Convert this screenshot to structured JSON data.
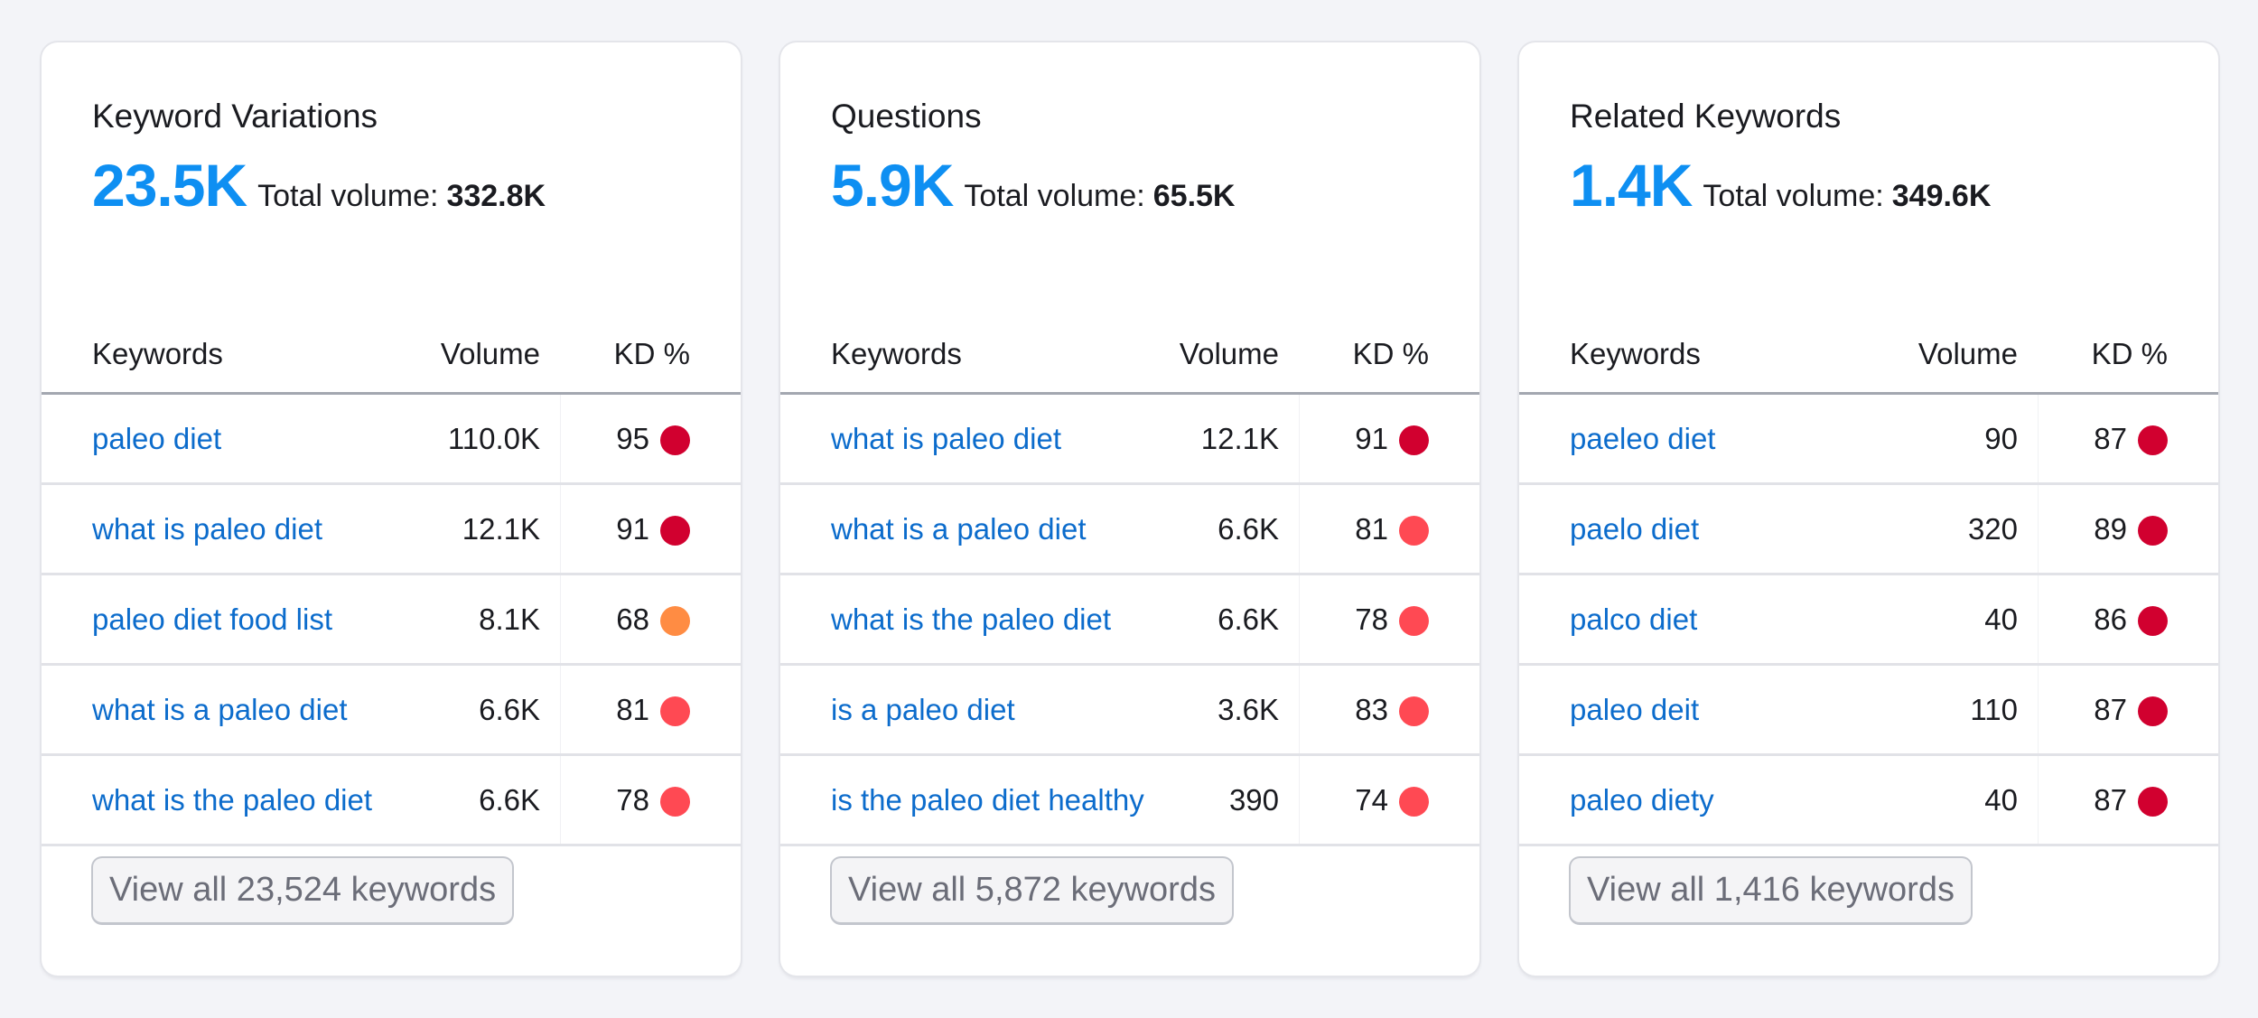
{
  "kd_colors": {
    "very_hard": "#d1002f",
    "hard": "#ff4953",
    "difficult": "#ff8c43"
  },
  "table_headers": {
    "keyword": "Keywords",
    "volume": "Volume",
    "kd": "KD %"
  },
  "cards": [
    {
      "title": "Keyword Variations",
      "count": "23.5K",
      "total_label": "Total volume:",
      "total_value": "332.8K",
      "rows": [
        {
          "keyword": "paleo diet",
          "volume": "110.0K",
          "kd": "95",
          "kd_level": "very_hard"
        },
        {
          "keyword": "what is paleo diet",
          "volume": "12.1K",
          "kd": "91",
          "kd_level": "very_hard"
        },
        {
          "keyword": "paleo diet food list",
          "volume": "8.1K",
          "kd": "68",
          "kd_level": "difficult"
        },
        {
          "keyword": "what is a paleo diet",
          "volume": "6.6K",
          "kd": "81",
          "kd_level": "hard"
        },
        {
          "keyword": "what is the paleo diet",
          "volume": "6.6K",
          "kd": "78",
          "kd_level": "hard"
        }
      ],
      "button_label": "View all 23,524 keywords"
    },
    {
      "title": "Questions",
      "count": "5.9K",
      "total_label": "Total volume:",
      "total_value": "65.5K",
      "rows": [
        {
          "keyword": "what is paleo diet",
          "volume": "12.1K",
          "kd": "91",
          "kd_level": "very_hard"
        },
        {
          "keyword": "what is a paleo diet",
          "volume": "6.6K",
          "kd": "81",
          "kd_level": "hard"
        },
        {
          "keyword": "what is the paleo diet",
          "volume": "6.6K",
          "kd": "78",
          "kd_level": "hard"
        },
        {
          "keyword": "is a paleo diet",
          "volume": "3.6K",
          "kd": "83",
          "kd_level": "hard"
        },
        {
          "keyword": "is the paleo diet healthy",
          "volume": "390",
          "kd": "74",
          "kd_level": "hard"
        }
      ],
      "button_label": "View all 5,872 keywords"
    },
    {
      "title": "Related Keywords",
      "count": "1.4K",
      "total_label": "Total volume:",
      "total_value": "349.6K",
      "rows": [
        {
          "keyword": "paeleo diet",
          "volume": "90",
          "kd": "87",
          "kd_level": "very_hard"
        },
        {
          "keyword": "paelo diet",
          "volume": "320",
          "kd": "89",
          "kd_level": "very_hard"
        },
        {
          "keyword": "palco diet",
          "volume": "40",
          "kd": "86",
          "kd_level": "very_hard"
        },
        {
          "keyword": "paleo deit",
          "volume": "110",
          "kd": "87",
          "kd_level": "very_hard"
        },
        {
          "keyword": "paleo diety",
          "volume": "40",
          "kd": "87",
          "kd_level": "very_hard"
        }
      ],
      "button_label": "View all 1,416 keywords"
    }
  ]
}
